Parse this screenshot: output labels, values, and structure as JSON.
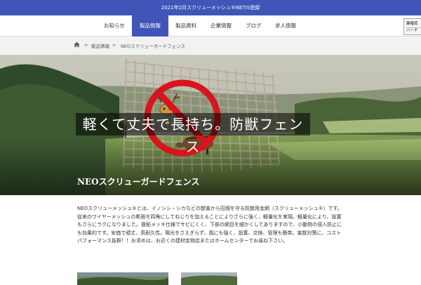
{
  "announcement": "2021年2月スクリューメッシュ®NETIS登録",
  "nav": {
    "items": [
      "お知らせ",
      "製品情報",
      "製品資料",
      "企業情報",
      "ブログ",
      "求人情報"
    ],
    "active": "製品情報"
  },
  "side_widget": {
    "line1": "離確認",
    "line2": "バーチ"
  },
  "breadcrumb": {
    "separator": ">",
    "items": [
      "製品情報",
      "NEOスクリューガードフェンス"
    ]
  },
  "hero": {
    "headline": "軽くて丈夫で長持ち。防獣フェンス",
    "product_title": "NEOスクリューガードフェンス"
  },
  "description": "NEOスクリューメッシュ®とは、イノシシ・シカなどの獣害から田畑を守る防獣用金網（スクリューメッシュ®）です。従来のワイヤーメッシュの断面を四角にしてねじりを加えることによりさらに強く、軽量化を実現。軽量化により、設置もさらにラクになりました。亜鉛メッキ仕様でサビにくく、下部の網目を細かくしてありますので、小動物の侵入防止にも効果的です。安価で頑丈、高耐久性。陽光をさえぎらず、風にも強く、設置、交換、管理も簡単。害獣対策に、コストパフォーマンス抜群！！お求めは、お近くの建材金物店またはホームセンターでお尋ね下さい。",
  "colors": {
    "brand_blue": "#3f56b8",
    "prohibition_red": "#d8141c"
  }
}
